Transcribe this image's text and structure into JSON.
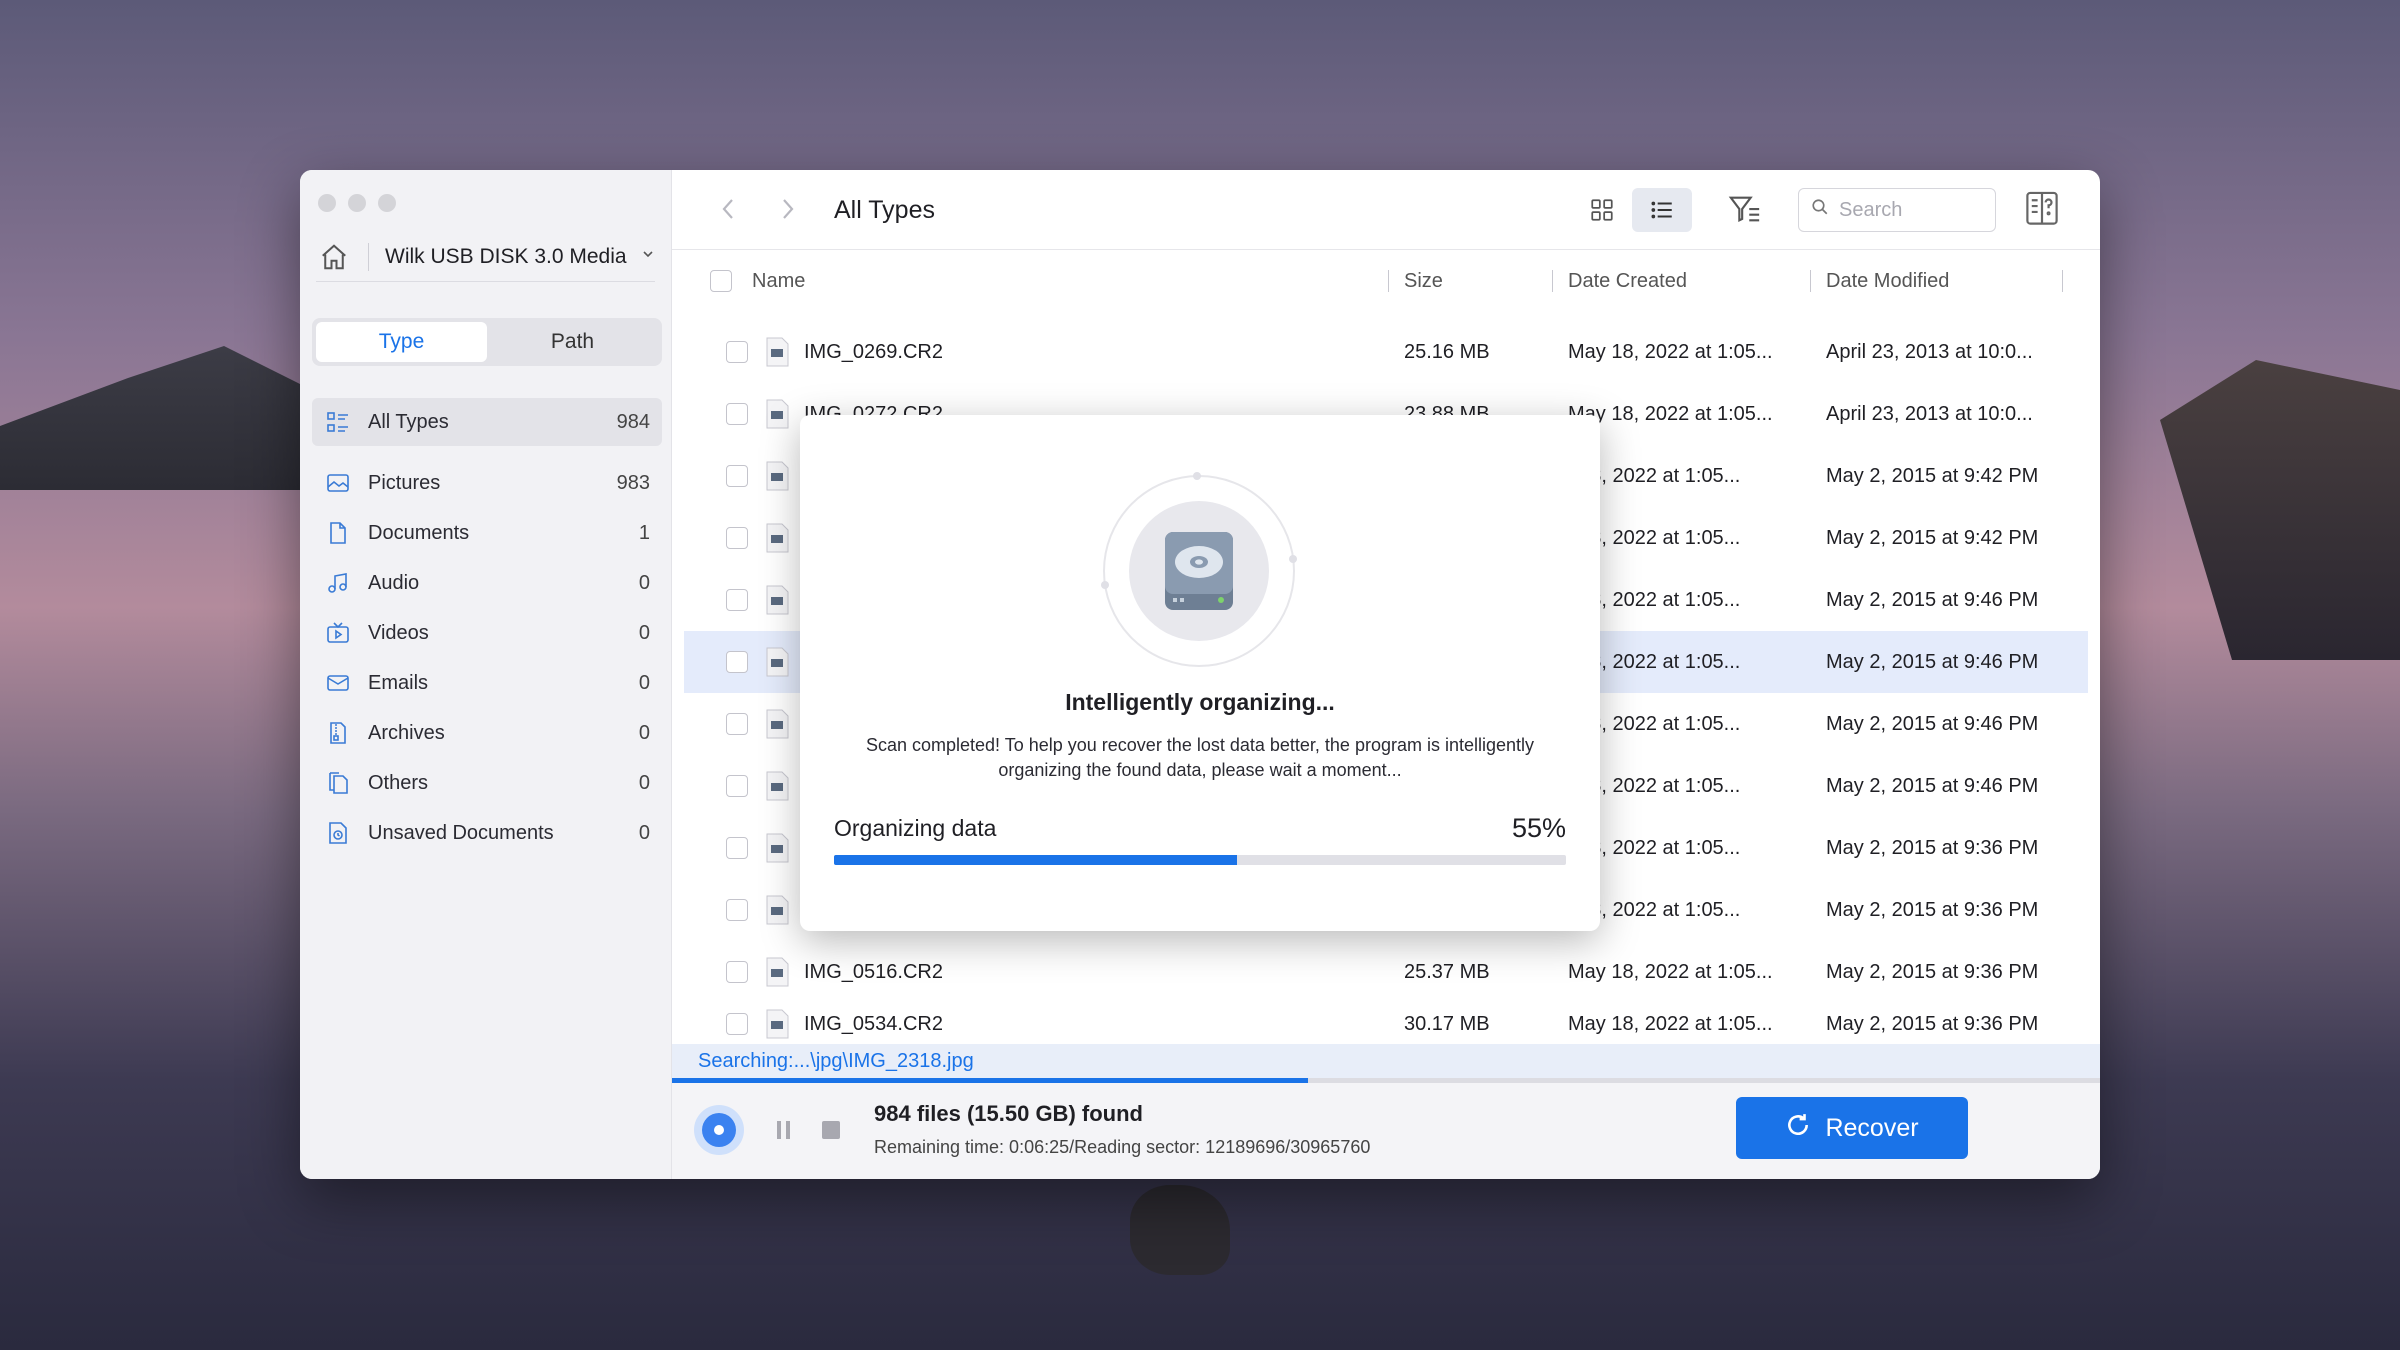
{
  "window": {
    "device": "Wilk USB DISK 3.0 Media",
    "title": "All Types"
  },
  "sidebar": {
    "tabs": [
      "Type",
      "Path"
    ],
    "items": [
      {
        "label": "All Types",
        "count": "984",
        "icon": "all-types-icon"
      },
      {
        "label": "Pictures",
        "count": "983",
        "icon": "picture-icon"
      },
      {
        "label": "Documents",
        "count": "1",
        "icon": "document-icon"
      },
      {
        "label": "Audio",
        "count": "0",
        "icon": "music-note-icon"
      },
      {
        "label": "Videos",
        "count": "0",
        "icon": "video-icon"
      },
      {
        "label": "Emails",
        "count": "0",
        "icon": "email-icon"
      },
      {
        "label": "Archives",
        "count": "0",
        "icon": "archive-icon"
      },
      {
        "label": "Others",
        "count": "0",
        "icon": "others-icon"
      },
      {
        "label": "Unsaved Documents",
        "count": "0",
        "icon": "unsaved-document-icon"
      }
    ]
  },
  "toolbar": {
    "search_placeholder": "Search"
  },
  "table": {
    "headers": {
      "name": "Name",
      "size": "Size",
      "created": "Date Created",
      "modified": "Date Modified"
    },
    "rows": [
      {
        "name": "IMG_0269.CR2",
        "size": "25.16 MB",
        "created": "May 18, 2022 at 1:05...",
        "modified": "April 23, 2013 at 10:0..."
      },
      {
        "name": "IMG_0272.CR2",
        "size": "23.88 MB",
        "created": "May 18, 2022 at 1:05...",
        "modified": "April 23, 2013 at 10:0..."
      },
      {
        "name": "I",
        "size": "",
        "created": "/ 18, 2022 at 1:05...",
        "modified": "May 2, 2015 at 9:42 PM"
      },
      {
        "name": "I",
        "size": "",
        "created": "/ 18, 2022 at 1:05...",
        "modified": "May 2, 2015 at 9:42 PM"
      },
      {
        "name": "I",
        "size": "",
        "created": "/ 18, 2022 at 1:05...",
        "modified": "May 2, 2015 at 9:46 PM"
      },
      {
        "name": "I",
        "size": "",
        "created": "/ 18, 2022 at 1:05...",
        "modified": "May 2, 2015 at 9:46 PM"
      },
      {
        "name": "I",
        "size": "",
        "created": "/ 18, 2022 at 1:05...",
        "modified": "May 2, 2015 at 9:46 PM"
      },
      {
        "name": "I",
        "size": "",
        "created": "/ 18, 2022 at 1:05...",
        "modified": "May 2, 2015 at 9:46 PM"
      },
      {
        "name": "I",
        "size": "",
        "created": "/ 18, 2022 at 1:05...",
        "modified": "May 2, 2015 at 9:36 PM"
      },
      {
        "name": "I",
        "size": "",
        "created": "/ 18, 2022 at 1:05...",
        "modified": "May 2, 2015 at 9:36 PM"
      },
      {
        "name": "IMG_0516.CR2",
        "size": "25.37 MB",
        "created": "May 18, 2022 at 1:05...",
        "modified": "May 2, 2015 at 9:36 PM"
      },
      {
        "name": "IMG_0534.CR2",
        "size": "30.17 MB",
        "created": "May 18, 2022 at 1:05...",
        "modified": "May 2, 2015 at 9:36 PM"
      }
    ]
  },
  "status": {
    "searching": "Searching:...\\jpg\\IMG_2318.jpg",
    "found": "984 files (15.50 GB) found",
    "remaining": "Remaining time: 0:06:25/Reading sector: 12189696/30965760",
    "recover_label": "Recover"
  },
  "modal": {
    "title": "Intelligently organizing...",
    "description": "Scan completed! To help you recover the lost data better, the program is intelligently organizing the found data, please wait a moment...",
    "progress_label": "Organizing data",
    "progress_text": "55%",
    "progress": 0.55
  },
  "colors": {
    "accent": "#1a73e8"
  }
}
